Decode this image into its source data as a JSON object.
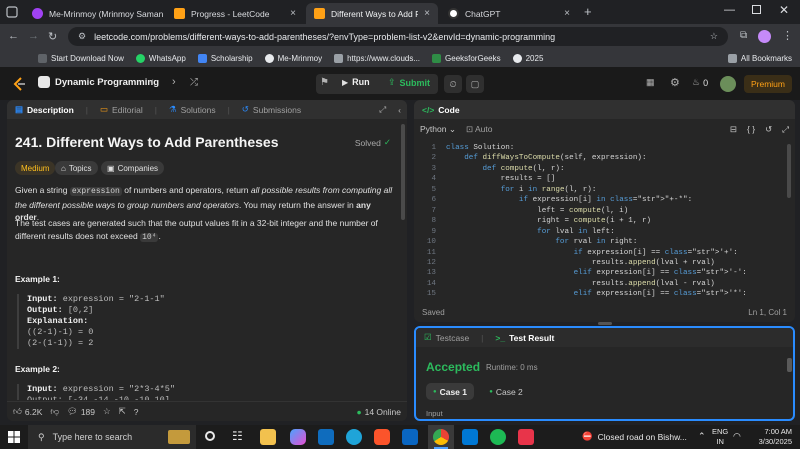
{
  "browser": {
    "tabs": [
      {
        "label": "Me-Mrinmoy (Mrinmoy Saman",
        "color": "#a142f4"
      },
      {
        "label": "Progress - LeetCode",
        "color": "#ffa116"
      },
      {
        "label": "Different Ways to Add Parenthe",
        "color": "#ffa116"
      },
      {
        "label": "ChatGPT",
        "color": "#ffffff"
      }
    ],
    "url": "leetcode.com/problems/different-ways-to-add-parentheses/?envType=problem-list-v2&envId=dynamic-programming",
    "bookmarks": [
      "Start Download Now",
      "WhatsApp",
      "Scholarship",
      "Me-Mrinmoy",
      "https://www.clouds...",
      "GeeksforGeeks",
      "2025"
    ],
    "all_bookmarks": "All Bookmarks"
  },
  "lc": {
    "list_title": "Dynamic Programming",
    "run": "Run",
    "submit": "Submit",
    "streak": "0",
    "premium": "Premium"
  },
  "left": {
    "tabs": [
      "Description",
      "Editorial",
      "Solutions",
      "Submissions"
    ],
    "title": "241. Different Ways to Add Parentheses",
    "solved": "Solved",
    "pills": [
      "Medium",
      "Topics",
      "Companies"
    ],
    "desc1_a": "Given a string",
    "desc1_code": "expression",
    "desc1_b": "of numbers and operators, return",
    "desc1_em": "all possible results from computing all the different possible ways to group numbers and operators",
    "desc1_c": ". You may return the answer in",
    "desc1_bold": "any order",
    "desc2_a": "The test cases are generated such that the output values fit in a 32-bit integer and the number of different results does not exceed",
    "desc2_code": "10⁴",
    "example1": {
      "head": "Example 1:",
      "input_label": "Input:",
      "input": "expression = \"2-1-1\"",
      "output_label": "Output:",
      "output": "[0,2]",
      "expl_label": "Explanation:",
      "lines": [
        "((2-1)-1) = 0",
        "(2-(1-1)) = 2"
      ]
    },
    "example2": {
      "head": "Example 2:",
      "input_label": "Input:",
      "input": "expression = \"2*3-4*5\"",
      "output_peek": "Output: [-34,-14,-10,-10,10]"
    },
    "footer": {
      "likes": "6.2K",
      "comments": "189",
      "online": "14 Online"
    }
  },
  "editor": {
    "tab": "Code",
    "language": "Python",
    "auto": "Auto",
    "saved": "Saved",
    "position": "Ln 1, Col 1",
    "lines": [
      "class Solution:",
      "    def diffWaysToCompute(self, expression):",
      "        def compute(l, r):",
      "            results = []",
      "            for i in range(l, r):",
      "                if expression[i] in \"+-*\":",
      "                    left = compute(l, i)",
      "                    right = compute(i + 1, r)",
      "                    for lval in left:",
      "                        for rval in right:",
      "                            if expression[i] == '+':",
      "                                results.append(lval + rval)",
      "                            elif expression[i] == '-':",
      "                                results.append(lval - rval)",
      "                            elif expression[i] == '*':"
    ]
  },
  "test": {
    "tab_testcase": "Testcase",
    "tab_result": "Test Result",
    "status": "Accepted",
    "runtime": "Runtime: 0 ms",
    "case1": "Case 1",
    "case2": "Case 2",
    "input_label": "Input"
  },
  "taskbar": {
    "search_placeholder": "Type here to search",
    "notification": "Closed road on Bishw...",
    "lang": "ENG",
    "region": "IN",
    "time": "7:00 AM",
    "date": "3/30/2025"
  },
  "colors": {
    "accepted": "#2cbb5d",
    "medium": "#ffc01e",
    "submit": "#2cbb5d",
    "premium": "#ffa116",
    "focus": "#2a8cff"
  }
}
